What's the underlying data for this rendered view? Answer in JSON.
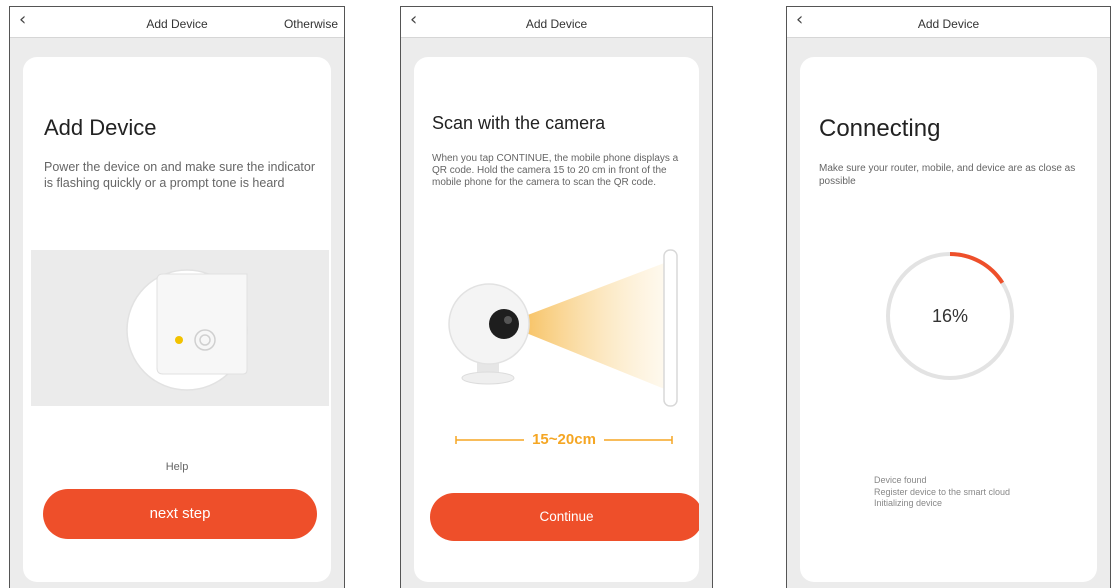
{
  "colors": {
    "accent": "#ee4f2a",
    "indicator": "#f2c200",
    "beam": "#f5b23c",
    "background": "#ececec"
  },
  "screen1": {
    "back_icon": "‹",
    "title": "Add Device",
    "otherwise": "Otherwise",
    "heading": "Add Device",
    "description": "Power the device on and make sure the indicator is flashing quickly or a prompt tone is heard",
    "help": "Help",
    "button": "next step"
  },
  "screen2": {
    "back_icon": "‹",
    "title": "Add Device",
    "heading": "Scan with the camera",
    "description": "When you tap CONTINUE, the mobile phone displays a QR code. Hold the camera 15 to 20 cm in front of the mobile phone for the camera to scan the QR code.",
    "distance_label": "15~20cm",
    "button": "Continue"
  },
  "screen3": {
    "back_icon": "‹",
    "title": "Add Device",
    "heading": "Connecting",
    "description": "Make sure your router, mobile, and device are as close as possible",
    "progress_percent": 16,
    "progress_label": "16%",
    "status": [
      "Device found",
      "Register device to the smart cloud",
      "Initializing device"
    ]
  }
}
